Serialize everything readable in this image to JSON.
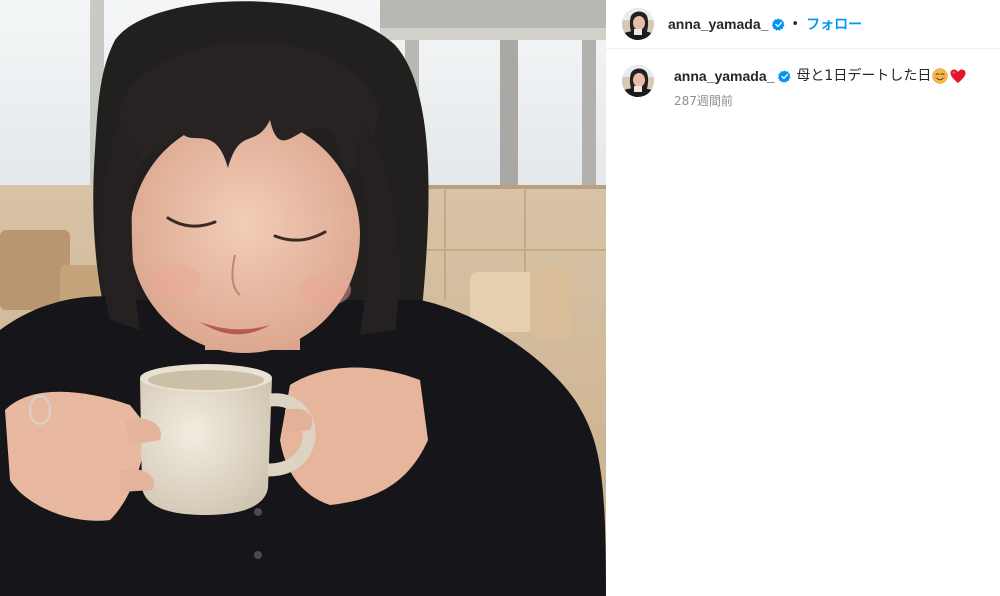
{
  "post": {
    "image_alt": "",
    "header": {
      "username": "anna_yamada_",
      "separator": "•",
      "follow_label": "フォロー"
    },
    "caption": {
      "username": "anna_yamada_",
      "text": "母と1日デートした日",
      "emojis": [
        "smiling-face-emoji",
        "red-heart-emoji"
      ]
    },
    "timestamp": "287週間前",
    "colors": {
      "link_blue": "#0095f6",
      "verified_blue": "#0095f6",
      "text": "#262626",
      "muted": "#8e8e8e"
    }
  }
}
